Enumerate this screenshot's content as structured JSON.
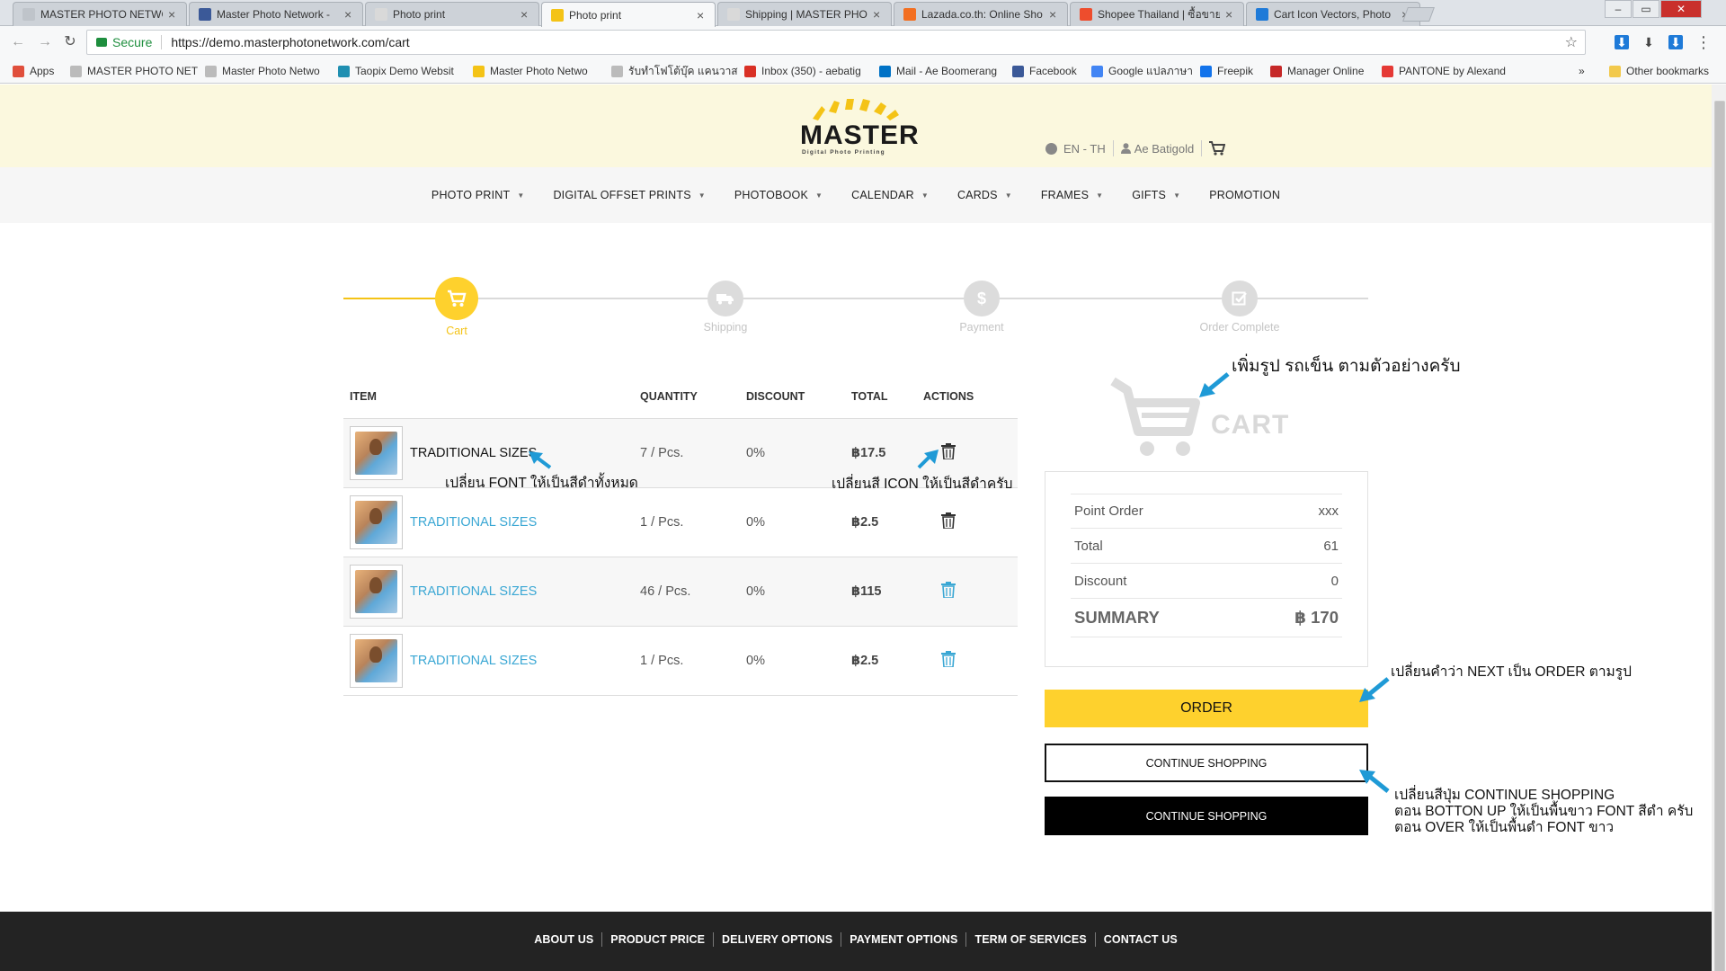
{
  "browser": {
    "tabs": [
      {
        "title": "MASTER PHOTO NETWO",
        "fav": "#bfc4ca"
      },
      {
        "title": "Master Photo Network -",
        "fav": "#3b5998"
      },
      {
        "title": "Photo print",
        "fav": "#d9d9d9"
      },
      {
        "title": "Photo print",
        "fav": "#f4c316",
        "active": true
      },
      {
        "title": "Shipping | MASTER PHO",
        "fav": "#d9d9d9"
      },
      {
        "title": "Lazada.co.th: Online Sho",
        "fav": "#f36f21"
      },
      {
        "title": "Shopee Thailand | ซื้อขาย",
        "fav": "#ee4d2d"
      },
      {
        "title": "Cart Icon Vectors, Photo",
        "fav": "#1e7ad8"
      }
    ],
    "address": {
      "secure_label": "Secure",
      "url": "https://demo.masterphotonetwork.com/cart"
    },
    "bookmarks": [
      {
        "label": "Apps",
        "color": "#e04f3c"
      },
      {
        "label": "MASTER PHOTO NET",
        "color": "#bbbbbb"
      },
      {
        "label": "Master Photo Netwo",
        "color": "#bbbbbb"
      },
      {
        "label": "Taopix Demo Websit",
        "color": "#1f8fb1"
      },
      {
        "label": "Master Photo Netwo",
        "color": "#f4c316"
      },
      {
        "label": "รับทำโฟโต้บุ๊ค แคนวาส",
        "color": "#bbbbbb"
      },
      {
        "label": "Inbox (350) - aebatig",
        "color": "#d93025"
      },
      {
        "label": "Mail - Ae Boomerang",
        "color": "#0072c6"
      },
      {
        "label": "Facebook",
        "color": "#3b5998"
      },
      {
        "label": "Google แปลภาษา",
        "color": "#4285f4"
      },
      {
        "label": "Freepik",
        "color": "#1273eb"
      },
      {
        "label": "Manager Online",
        "color": "#c62828"
      },
      {
        "label": "PANTONE by Alexand",
        "color": "#e53935"
      }
    ],
    "overflow_label": "»",
    "other_bookmarks": "Other bookmarks"
  },
  "header": {
    "logo_word": "MASTER",
    "logo_tagline": "Digital Photo Printing",
    "language": "EN - TH",
    "user": "Ae Batigold"
  },
  "nav": [
    {
      "label": "PHOTO PRINT",
      "caret": true
    },
    {
      "label": "DIGITAL OFFSET PRINTS",
      "caret": true
    },
    {
      "label": "PHOTOBOOK",
      "caret": true
    },
    {
      "label": "CALENDAR",
      "caret": true
    },
    {
      "label": "CARDS",
      "caret": true
    },
    {
      "label": "FRAMES",
      "caret": true
    },
    {
      "label": "GIFTS",
      "caret": true
    },
    {
      "label": "PROMOTION",
      "caret": false
    }
  ],
  "steps": [
    {
      "label": "Cart",
      "active": true,
      "icon": "cart-icon"
    },
    {
      "label": "Shipping",
      "active": false,
      "icon": "truck-icon"
    },
    {
      "label": "Payment",
      "active": false,
      "icon": "dollar-icon"
    },
    {
      "label": "Order Complete",
      "active": false,
      "icon": "check-icon"
    }
  ],
  "cart": {
    "headers": {
      "item": "ITEM",
      "quantity": "QUANTITY",
      "discount": "DISCOUNT",
      "total": "TOTAL",
      "actions": "ACTIONS"
    },
    "rows": [
      {
        "name": "TRADITIONAL SIZES",
        "qty": "7  /  Pcs.",
        "discount": "0%",
        "total": "฿17.5",
        "name_color": "#111111",
        "icon_color": "#333333"
      },
      {
        "name": "TRADITIONAL SIZES",
        "qty": "1  /  Pcs.",
        "discount": "0%",
        "total": "฿2.5",
        "name_color": "#3aa7d4",
        "icon_color": "#333333"
      },
      {
        "name": "TRADITIONAL SIZES",
        "qty": "46  /  Pcs.",
        "discount": "0%",
        "total": "฿115",
        "name_color": "#3aa7d4",
        "icon_color": "#3aa7d4"
      },
      {
        "name": "TRADITIONAL SIZES",
        "qty": "1  /  Pcs.",
        "discount": "0%",
        "total": "฿2.5",
        "name_color": "#3aa7d4",
        "icon_color": "#3aa7d4"
      }
    ]
  },
  "cart_graphic": {
    "label": "CART"
  },
  "summary": {
    "point_order_label": "Point Order",
    "point_order_value": "xxx",
    "total_label": "Total",
    "total_value": "61",
    "discount_label": "Discount",
    "discount_value": "0",
    "summary_label": "SUMMARY",
    "summary_value": "฿ 170"
  },
  "buttons": {
    "order": "ORDER",
    "continue_1": "CONTINUE SHOPPING",
    "continue_2": "CONTINUE SHOPPING"
  },
  "annotations": {
    "cart_image": "เพิ่มรูป รถเข็น ตามตัวอย่างครับ",
    "font_black": "เปลี่ยน FONT ให้เป็นสีดำทั้งหมด",
    "icon_black": "เปลี่ยนสี ICON  ให้เป็นสีดำครับ",
    "next_to_order": "เปลี่ยนคำว่า NEXT เป็น  ORDER ตามรูป",
    "continue_line1": "เปลี่ยนสีปุ่ม CONTINUE SHOPPING",
    "continue_line2": "ตอน BOTTON UP ให้เป็นพื้นขาว FONT สีดำ ครับ",
    "continue_line3": "ตอน OVER ให้เป็นพื้นดำ FONT ขาว"
  },
  "footer": [
    "ABOUT US",
    "PRODUCT PRICE",
    "DELIVERY OPTIONS",
    "PAYMENT OPTIONS",
    "TERM OF SERVICES",
    "CONTACT US"
  ],
  "colors": {
    "brand_yellow": "#fed12d",
    "step_active": "#f4c316",
    "link_blue": "#3aa7d4",
    "annotation_arrow": "#1f9ad6"
  }
}
